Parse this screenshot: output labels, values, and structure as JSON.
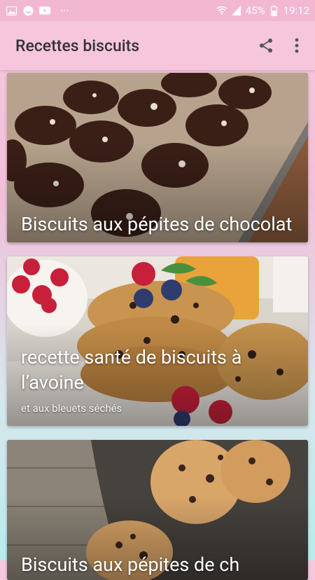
{
  "status_bar": {
    "battery_percent": "45%",
    "time": "19:12",
    "icons": [
      "gallery-icon",
      "face-icon",
      "youtube-icon",
      "more-notifications-icon",
      "wifi-icon",
      "signal-icon",
      "battery-icon"
    ],
    "dots": "···"
  },
  "app_bar": {
    "title": "Recettes biscuits",
    "actions": [
      "share-icon",
      "more-vert-icon"
    ],
    "color": "#f6c6dc"
  },
  "cards": [
    {
      "title": "Biscuits aux pépites de chocolat",
      "subtitle": ""
    },
    {
      "title": "recette santé de biscuits à l’avoine",
      "subtitle": "et aux bleuets séchés"
    },
    {
      "title": "Biscuits aux pépites de ch",
      "subtitle": ""
    }
  ]
}
